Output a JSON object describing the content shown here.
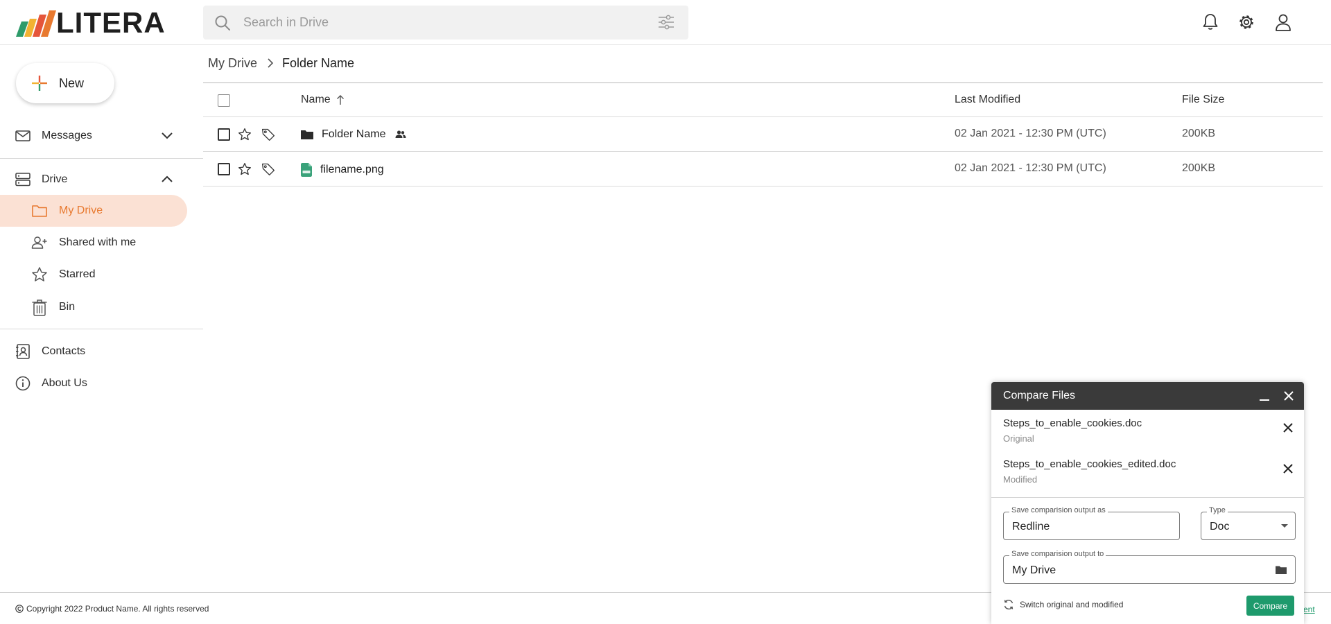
{
  "app": {
    "brand": "LITERA"
  },
  "search": {
    "placeholder": "Search in Drive"
  },
  "sidebar": {
    "new_label": "New",
    "messages": "Messages",
    "drive": "Drive",
    "drive_items": [
      {
        "label": "My Drive",
        "icon": "folder-icon",
        "active": true
      },
      {
        "label": "Shared with me",
        "icon": "add-user-icon"
      },
      {
        "label": "Starred",
        "icon": "star-icon"
      },
      {
        "label": "Bin",
        "icon": "trash-icon"
      }
    ],
    "contacts": "Contacts",
    "about": "About Us"
  },
  "breadcrumb": {
    "root": "My Drive",
    "current": "Folder Name"
  },
  "table": {
    "headers": {
      "name": "Name",
      "modified": "Last Modified",
      "size": "File Size"
    },
    "rows": [
      {
        "name": "Folder Name",
        "type": "folder",
        "shared": true,
        "modified": "02 Jan 2021 - 12:30 PM (UTC)",
        "size": "200KB"
      },
      {
        "name": "filename.png",
        "type": "png",
        "shared": false,
        "modified": "02 Jan 2021 - 12:30 PM (UTC)",
        "size": "200KB"
      }
    ]
  },
  "footer": {
    "copyright": "Copyright 2022 Product Name. All rights reserved",
    "link_fragment": "ent"
  },
  "compare": {
    "title": "Compare Files",
    "files": [
      {
        "name": "Steps_to_enable_cookies.doc",
        "role": "Original"
      },
      {
        "name": "Steps_to_enable_cookies_edited.doc",
        "role": "Modified"
      }
    ],
    "output_as_label": "Save comparision output as",
    "output_as_value": "Redline",
    "type_label": "Type",
    "type_value": "Doc",
    "output_to_label": "Save comparision output to",
    "output_to_value": "My Drive",
    "switch_label": "Switch original and modified",
    "compare_button": "Compare"
  },
  "colors": {
    "accent": "#e8792f",
    "active_bg": "#fbe1d4",
    "primary_button": "#1e9a6c",
    "panel_header": "#3a3a3a"
  }
}
